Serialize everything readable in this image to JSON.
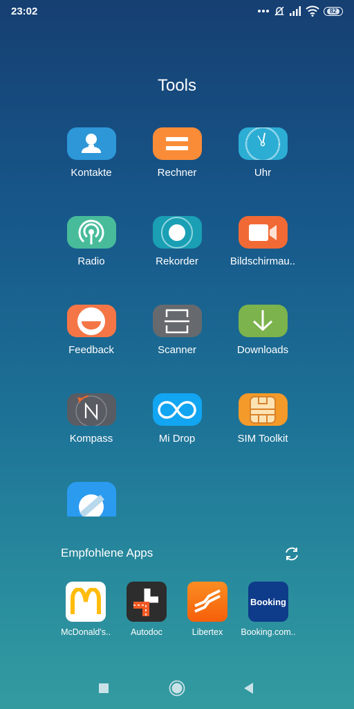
{
  "status_bar": {
    "time": "23:02",
    "battery_level": "82",
    "icons": [
      "more-dots-icon",
      "bell-muted-icon",
      "signal-icon",
      "wifi-icon",
      "battery-icon"
    ]
  },
  "folder": {
    "title": "Tools",
    "apps": [
      {
        "label": "Kontakte",
        "icon": "contacts-icon",
        "color": "#2d97d8"
      },
      {
        "label": "Rechner",
        "icon": "calculator-icon",
        "color": "#fa8c38"
      },
      {
        "label": "Uhr",
        "icon": "clock-icon",
        "color": "#2cadd4"
      },
      {
        "label": "Radio",
        "icon": "radio-icon",
        "color": "#48bc9a"
      },
      {
        "label": "Rekorder",
        "icon": "recorder-icon",
        "color": "#1a9fb4"
      },
      {
        "label": "Bildschirmau..",
        "icon": "screen-recorder-icon",
        "color": "#f16a35"
      },
      {
        "label": "Feedback",
        "icon": "feedback-icon",
        "color": "#f47647"
      },
      {
        "label": "Scanner",
        "icon": "scanner-icon",
        "color": "#666a6e"
      },
      {
        "label": "Downloads",
        "icon": "download-icon",
        "color": "#7cb34d"
      },
      {
        "label": "Kompass",
        "icon": "compass-icon",
        "color": "#595c63"
      },
      {
        "label": "Mi Drop",
        "icon": "mi-drop-icon",
        "color": "#12a5f2"
      },
      {
        "label": "SIM Toolkit",
        "icon": "sim-card-icon",
        "color": "#f39a2a"
      },
      {
        "label": "",
        "icon": "browser-icon",
        "color": "#2b9bf0"
      }
    ]
  },
  "recommended": {
    "title": "Empfohlene Apps",
    "refresh_icon": "refresh-icon",
    "apps": [
      {
        "label": "McDonald's..",
        "icon": "mcdonalds-icon",
        "color": "#ffffff"
      },
      {
        "label": "Autodoc",
        "icon": "autodoc-icon",
        "color": "#2d2d2d"
      },
      {
        "label": "Libertex",
        "icon": "libertex-icon",
        "color": "#f96c0e"
      },
      {
        "label": "Booking.com..",
        "icon": "booking-icon",
        "color": "#003580",
        "logo_text": "Booking"
      }
    ]
  },
  "nav_bar": {
    "buttons": [
      "recents-button",
      "home-button",
      "back-button"
    ]
  }
}
